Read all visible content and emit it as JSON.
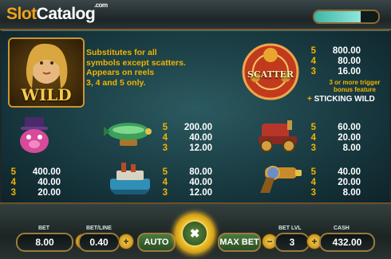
{
  "logo": {
    "slot": "Slot",
    "catalog": "Catalog",
    "com": ".com"
  },
  "meter": {
    "level": 0.72
  },
  "wild": {
    "symbol_text": "WILD",
    "lines": [
      "Substitutes for all",
      "symbols except scatters.",
      "Appears on reels",
      "3, 4 and 5 only."
    ]
  },
  "scatter": {
    "symbol_text": "SCATTER",
    "pays": [
      {
        "n": "5",
        "v": "800.00"
      },
      {
        "n": "4",
        "v": "80.00"
      },
      {
        "n": "3",
        "v": "16.00"
      }
    ],
    "note_lines": [
      "3 or more trigger",
      "bonus feature"
    ],
    "plus": "+",
    "feature": "STICKING WILD"
  },
  "airship": {
    "pays": [
      {
        "n": "5",
        "v": "200.00"
      },
      {
        "n": "4",
        "v": "40.00"
      },
      {
        "n": "3",
        "v": "12.00"
      }
    ]
  },
  "car": {
    "pays": [
      {
        "n": "5",
        "v": "60.00"
      },
      {
        "n": "4",
        "v": "20.00"
      },
      {
        "n": "3",
        "v": "8.00"
      }
    ]
  },
  "villain": {
    "pays": [
      {
        "n": "5",
        "v": "400.00"
      },
      {
        "n": "4",
        "v": "40.00"
      },
      {
        "n": "3",
        "v": "20.00"
      }
    ]
  },
  "boat": {
    "pays": [
      {
        "n": "5",
        "v": "80.00"
      },
      {
        "n": "4",
        "v": "40.00"
      },
      {
        "n": "3",
        "v": "12.00"
      }
    ]
  },
  "gun": {
    "pays": [
      {
        "n": "5",
        "v": "40.00"
      },
      {
        "n": "4",
        "v": "20.00"
      },
      {
        "n": "3",
        "v": "8.00"
      }
    ]
  },
  "controls": {
    "bet_label": "BET",
    "bet_value": "8.00",
    "betline_label": "BET/LINE",
    "betline_value": "0.40",
    "minus": "−",
    "plus": "+",
    "auto": "AUTO",
    "spin_icon": "✖",
    "maxbet": "MAX BET",
    "betlvl_label": "BET LVL",
    "betlvl_value": "3",
    "cash_label": "CASH",
    "cash_value": "432.00"
  }
}
